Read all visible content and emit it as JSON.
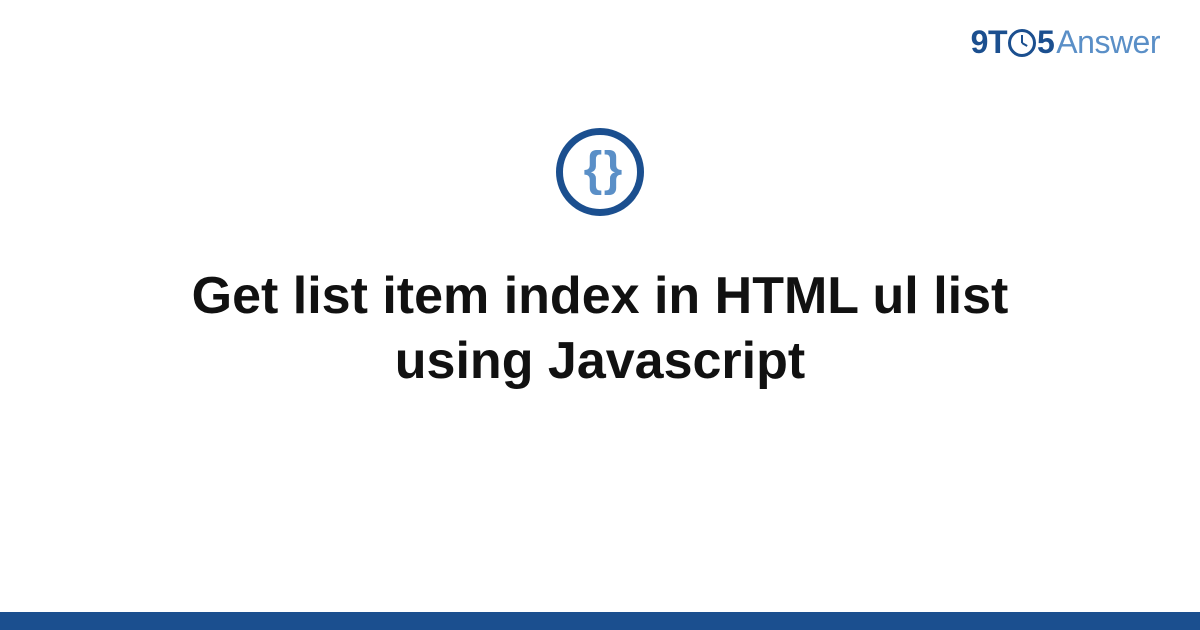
{
  "header": {
    "logo": {
      "prefix": "9T",
      "middle_digit": "5",
      "suffix": "Answer"
    }
  },
  "content": {
    "icon_glyph": "{ }",
    "title": "Get list item index in HTML ul list using Javascript"
  },
  "colors": {
    "brand_dark": "#1b4f8f",
    "brand_light": "#5a8fc7",
    "text": "#111111",
    "background": "#ffffff"
  }
}
